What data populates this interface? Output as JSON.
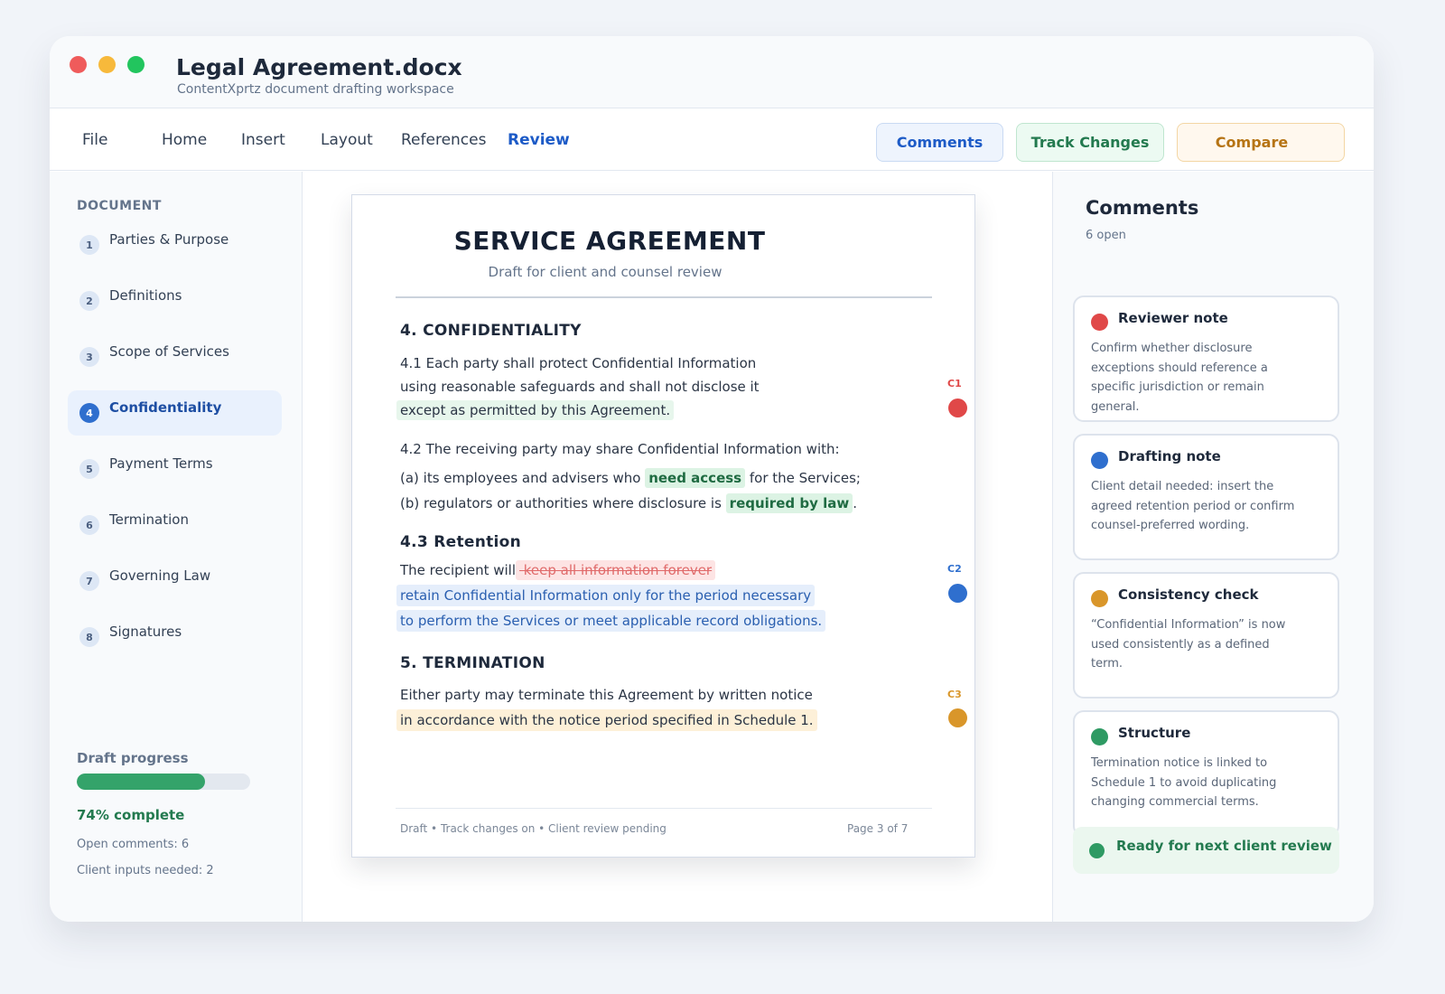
{
  "window": {
    "title": "Legal Agreement.docx",
    "subtitle": "ContentXprtz document drafting workspace"
  },
  "menu": [
    "File",
    "Home",
    "Insert",
    "Layout",
    "References",
    "Review"
  ],
  "menu_active": "Review",
  "toolbar": {
    "comments_label": "Comments",
    "track_changes_label": "Track Changes",
    "compare_label": "Compare"
  },
  "sidebar": {
    "heading": "DOCUMENT",
    "items": [
      {
        "num": "1",
        "label": "Parties & Purpose"
      },
      {
        "num": "2",
        "label": "Definitions"
      },
      {
        "num": "3",
        "label": "Scope of Services"
      },
      {
        "num": "4",
        "label": "Confidentiality"
      },
      {
        "num": "5",
        "label": "Payment Terms"
      },
      {
        "num": "6",
        "label": "Termination"
      },
      {
        "num": "7",
        "label": "Governing Law"
      },
      {
        "num": "8",
        "label": "Signatures"
      }
    ],
    "active_index": 3,
    "progress_label": "Draft progress",
    "progress_value": 0.74,
    "progress_text": "74% complete",
    "open_comments": "Open comments: 6",
    "client_inputs": "Client inputs needed: 2"
  },
  "document": {
    "title": "SERVICE AGREEMENT",
    "subtitle": "Draft for client and counsel review",
    "s4_heading": "4. CONFIDENTIALITY",
    "p41_line1": "4.1  Each party shall protect Confidential Information",
    "p41_line2": "using reasonable safeguards and shall not disclose it",
    "p41_line3": "except as permitted by this Agreement.",
    "p42_intro": "4.2  The receiving party may share Confidential Information with:",
    "p42_a_pre": "(a) its employees and advisers who ",
    "p42_a_chip": "need access",
    "p42_a_post": " for the Services;",
    "p42_b_pre": "(b) regulators or authorities where disclosure is ",
    "p42_b_chip": "required by law",
    "p42_b_post": ".",
    "s43_heading": "4.3  Retention",
    "p43_pre": "The recipient will",
    "p43_deleted": " keep all information forever",
    "p43_ins1": "retain Confidential Information only for the period necessary",
    "p43_ins2": "to perform the Services or meet applicable record obligations.",
    "s5_heading": "5. TERMINATION",
    "p5_line1": "Either party may terminate this Agreement by written notice",
    "p5_line2": "in accordance with the notice period specified in Schedule 1.",
    "footer_left": "Draft • Track changes on • Client review pending",
    "footer_right": "Page 3 of 7"
  },
  "markers": [
    {
      "label": "C1",
      "color": "#e04848"
    },
    {
      "label": "C2",
      "color": "#2f6fce"
    },
    {
      "label": "C3",
      "color": "#d9962a"
    }
  ],
  "comments_panel": {
    "title": "Comments",
    "count": "6 open",
    "cards": [
      {
        "title": "Reviewer note",
        "color": "#e04848",
        "body": "Confirm whether disclosure exceptions should reference a specific jurisdiction or remain general."
      },
      {
        "title": "Drafting note",
        "color": "#2f6fce",
        "body": "Client detail needed: insert the agreed retention period or confirm counsel-preferred wording."
      },
      {
        "title": "Consistency check",
        "color": "#d9962a",
        "body": "“Confidential Information” is now used consistently as a defined term."
      },
      {
        "title": "Structure",
        "color": "#2e9a63",
        "body": "Termination notice is linked to Schedule 1 to avoid duplicating changing commercial terms."
      }
    ],
    "ready_text": "Ready for next client review"
  },
  "colors": {
    "accent": "#1d5bc7",
    "success": "#34a36a",
    "warning": "#d9962a",
    "danger": "#e04848"
  }
}
